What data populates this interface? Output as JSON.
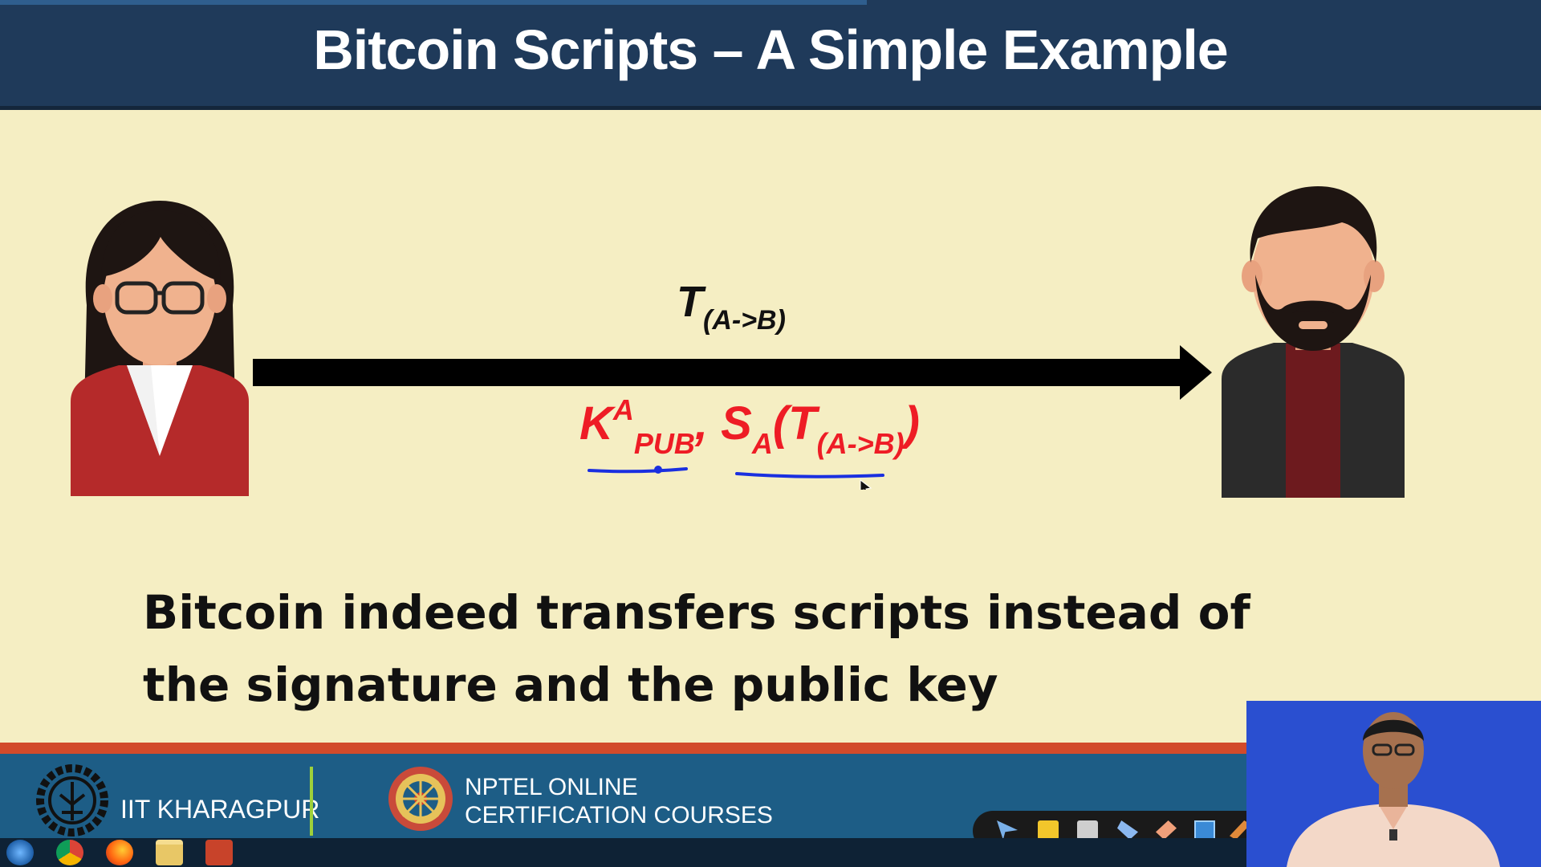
{
  "slide": {
    "title": "Bitcoin Scripts – A Simple Example",
    "transaction_label": {
      "main": "T",
      "sub": "(A->B)"
    },
    "signature_label": {
      "k": "K",
      "k_sup": "A",
      "k_sub": "PUB",
      "comma": ",",
      "s": "S",
      "s_sub": "A",
      "paren_open": "(",
      "t": "T",
      "t_sub": "(A->B)",
      "paren_close": ")"
    },
    "statement": "Bitcoin indeed transfers scripts instead of the signature and the public key"
  },
  "footer": {
    "institute": "IIT KHARAGPUR",
    "nptel_line1": "NPTEL ONLINE",
    "nptel_line2": "CERTIFICATION COURSES"
  },
  "taskbar": {
    "icons": [
      "windows-start-icon",
      "chrome-icon",
      "firefox-icon",
      "file-explorer-icon",
      "powerpoint-icon"
    ]
  },
  "colors": {
    "title_bg": "#1f3a5a",
    "slide_bg": "#f5eec3",
    "signature_red": "#ee1c25",
    "ink_blue": "#1a2fe0",
    "footer_blue": "#1d5d86",
    "footer_red": "#d24a2a"
  }
}
